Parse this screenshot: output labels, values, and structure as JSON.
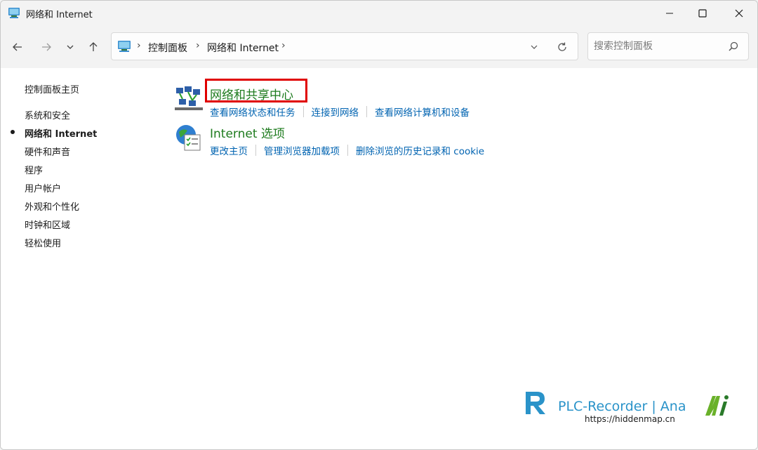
{
  "window": {
    "title": "网络和 Internet"
  },
  "nav": {
    "back_icon": "arrow-left-icon",
    "forward_icon": "arrow-right-icon",
    "recent_icon": "chevron-down-icon",
    "up_icon": "arrow-up-icon"
  },
  "address": {
    "crumbs": [
      "控制面板",
      "网络和 Internet"
    ],
    "separator": "›"
  },
  "search": {
    "placeholder": "搜索控制面板"
  },
  "sidebar": {
    "home": "控制面板主页",
    "items": [
      {
        "label": "系统和安全",
        "active": false
      },
      {
        "label": "网络和 Internet",
        "active": true
      },
      {
        "label": "硬件和声音",
        "active": false
      },
      {
        "label": "程序",
        "active": false
      },
      {
        "label": "用户帐户",
        "active": false
      },
      {
        "label": "外观和个性化",
        "active": false
      },
      {
        "label": "时钟和区域",
        "active": false
      },
      {
        "label": "轻松使用",
        "active": false
      }
    ]
  },
  "categories": [
    {
      "title": "网络和共享中心",
      "icon": "network-sharing-icon",
      "links": [
        "查看网络状态和任务",
        "连接到网络",
        "查看网络计算机和设备"
      ]
    },
    {
      "title": "Internet 选项",
      "icon": "internet-options-icon",
      "links": [
        "更改主页",
        "管理浏览器加载项",
        "删除浏览的历史记录和 cookie"
      ]
    }
  ],
  "colors": {
    "category_title": "#1e7b1e",
    "link": "#0063b1",
    "highlight": "#e00000"
  },
  "watermark": {
    "brand": "PLC-Recorder | Ana",
    "url": "https://hiddenmap.cn"
  }
}
